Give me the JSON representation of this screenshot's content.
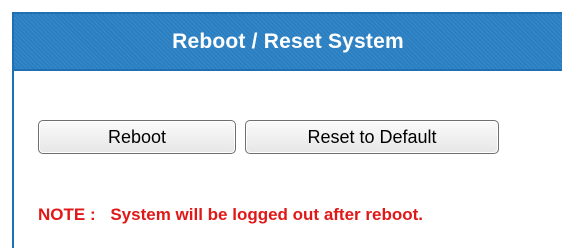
{
  "panel": {
    "title": "Reboot / Reset System"
  },
  "actions": {
    "reboot_label": "Reboot",
    "reset_label": "Reset to Default"
  },
  "note": {
    "label": "NOTE :",
    "text": "System will be logged out after reboot."
  },
  "colors": {
    "header_blue": "#2a7fc2",
    "border_blue": "#1f6fb3",
    "note_red": "#e01818"
  }
}
